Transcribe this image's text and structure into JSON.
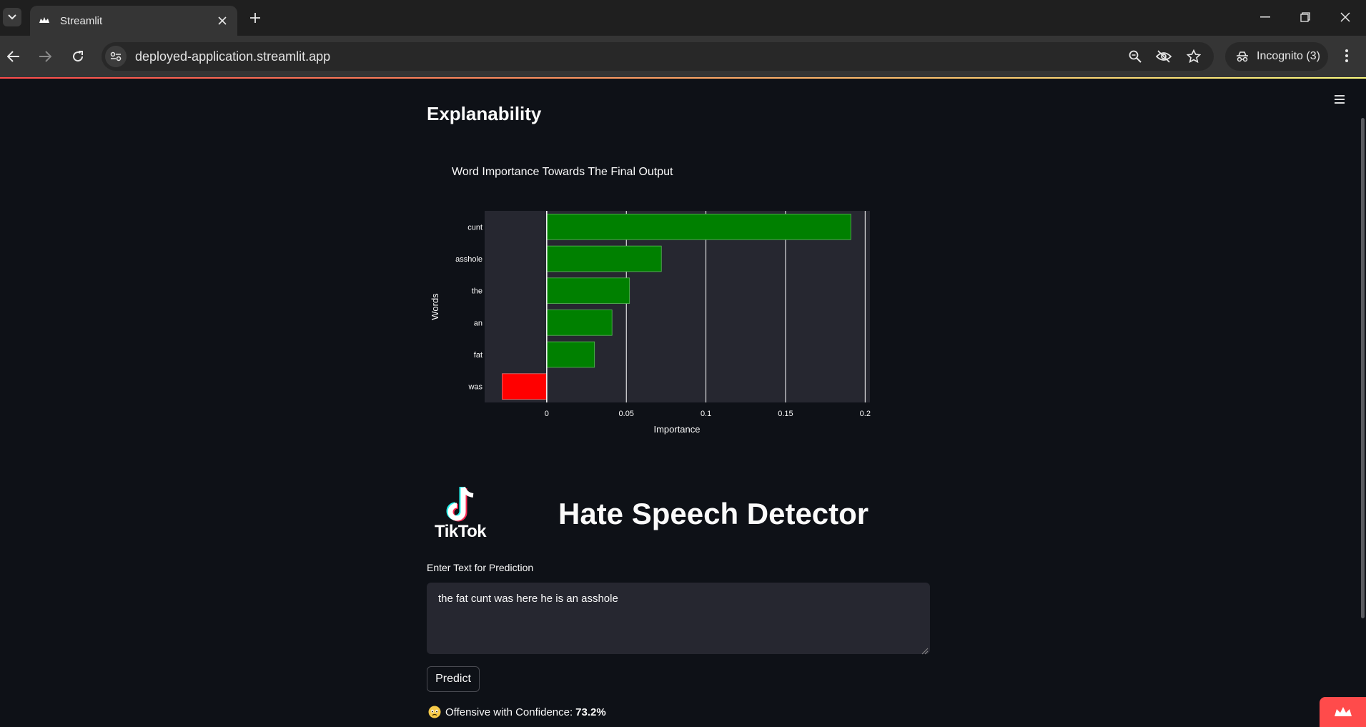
{
  "browser": {
    "tab_title": "Streamlit",
    "url": "deployed-application.streamlit.app",
    "incognito_label": "Incognito (3)"
  },
  "app": {
    "section_title": "Explanability",
    "app_title": "Hate Speech Detector",
    "logo_text": "TikTok",
    "input_label": "Enter Text for Prediction",
    "input_value": "the fat cunt was here he is an asshole",
    "predict_label": "Predict",
    "result_text": "Offensive with Confidence:",
    "result_confidence": "73.2%",
    "result_emoji": "worried-face-icon"
  },
  "chart_data": {
    "type": "bar",
    "orientation": "horizontal",
    "title": "Word Importance Towards The Final Output",
    "xlabel": "Importance",
    "ylabel": "Words",
    "categories": [
      "cunt",
      "asshole",
      "the",
      "an",
      "fat",
      "was"
    ],
    "values": [
      0.191,
      0.072,
      0.052,
      0.041,
      0.03,
      -0.028
    ],
    "xlim": [
      -0.039,
      0.203
    ],
    "xticks": [
      0,
      0.05,
      0.1,
      0.15,
      0.2
    ],
    "xtick_labels": [
      "0",
      "0.05",
      "0.1",
      "0.15",
      "0.2"
    ],
    "positive_color": "#008000",
    "negative_color": "#ff0000",
    "plot_bg": "#262730",
    "grid": true
  },
  "colors": {
    "accent": "#ff4b4b",
    "background": "#0e1117"
  }
}
